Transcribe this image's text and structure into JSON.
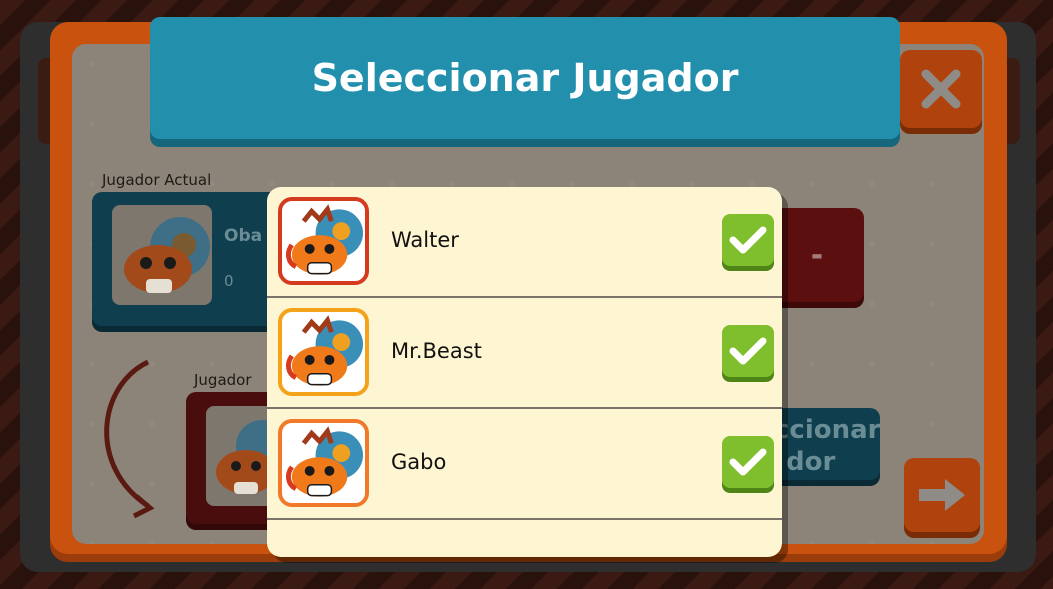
{
  "modal": {
    "title": "Seleccionar Jugador",
    "players": [
      {
        "name": "Walter",
        "selected": true,
        "frame_color": "#d63a1e"
      },
      {
        "name": "Mr.Beast",
        "selected": true,
        "frame_color": "#f5a21b"
      },
      {
        "name": "Gabo",
        "selected": true,
        "frame_color": "#f07a2a"
      }
    ]
  },
  "background": {
    "current_player_label": "Jugador Actual",
    "current_player_name": "Oba",
    "current_player_score": "0",
    "next_player_label": "Jugador",
    "minus_label": "-",
    "select_button_line1": "ccionar",
    "select_button_line2": "dor"
  },
  "icons": {
    "close": "close-x-icon",
    "next": "arrow-right-icon",
    "check": "checkmark-icon",
    "avatar": "hermit-crab-avatar"
  },
  "colors": {
    "accent_orange": "#c9520f",
    "title_blue": "#2290ad",
    "modal_bg": "#fef6d3",
    "check_green": "#7fbf2e"
  }
}
